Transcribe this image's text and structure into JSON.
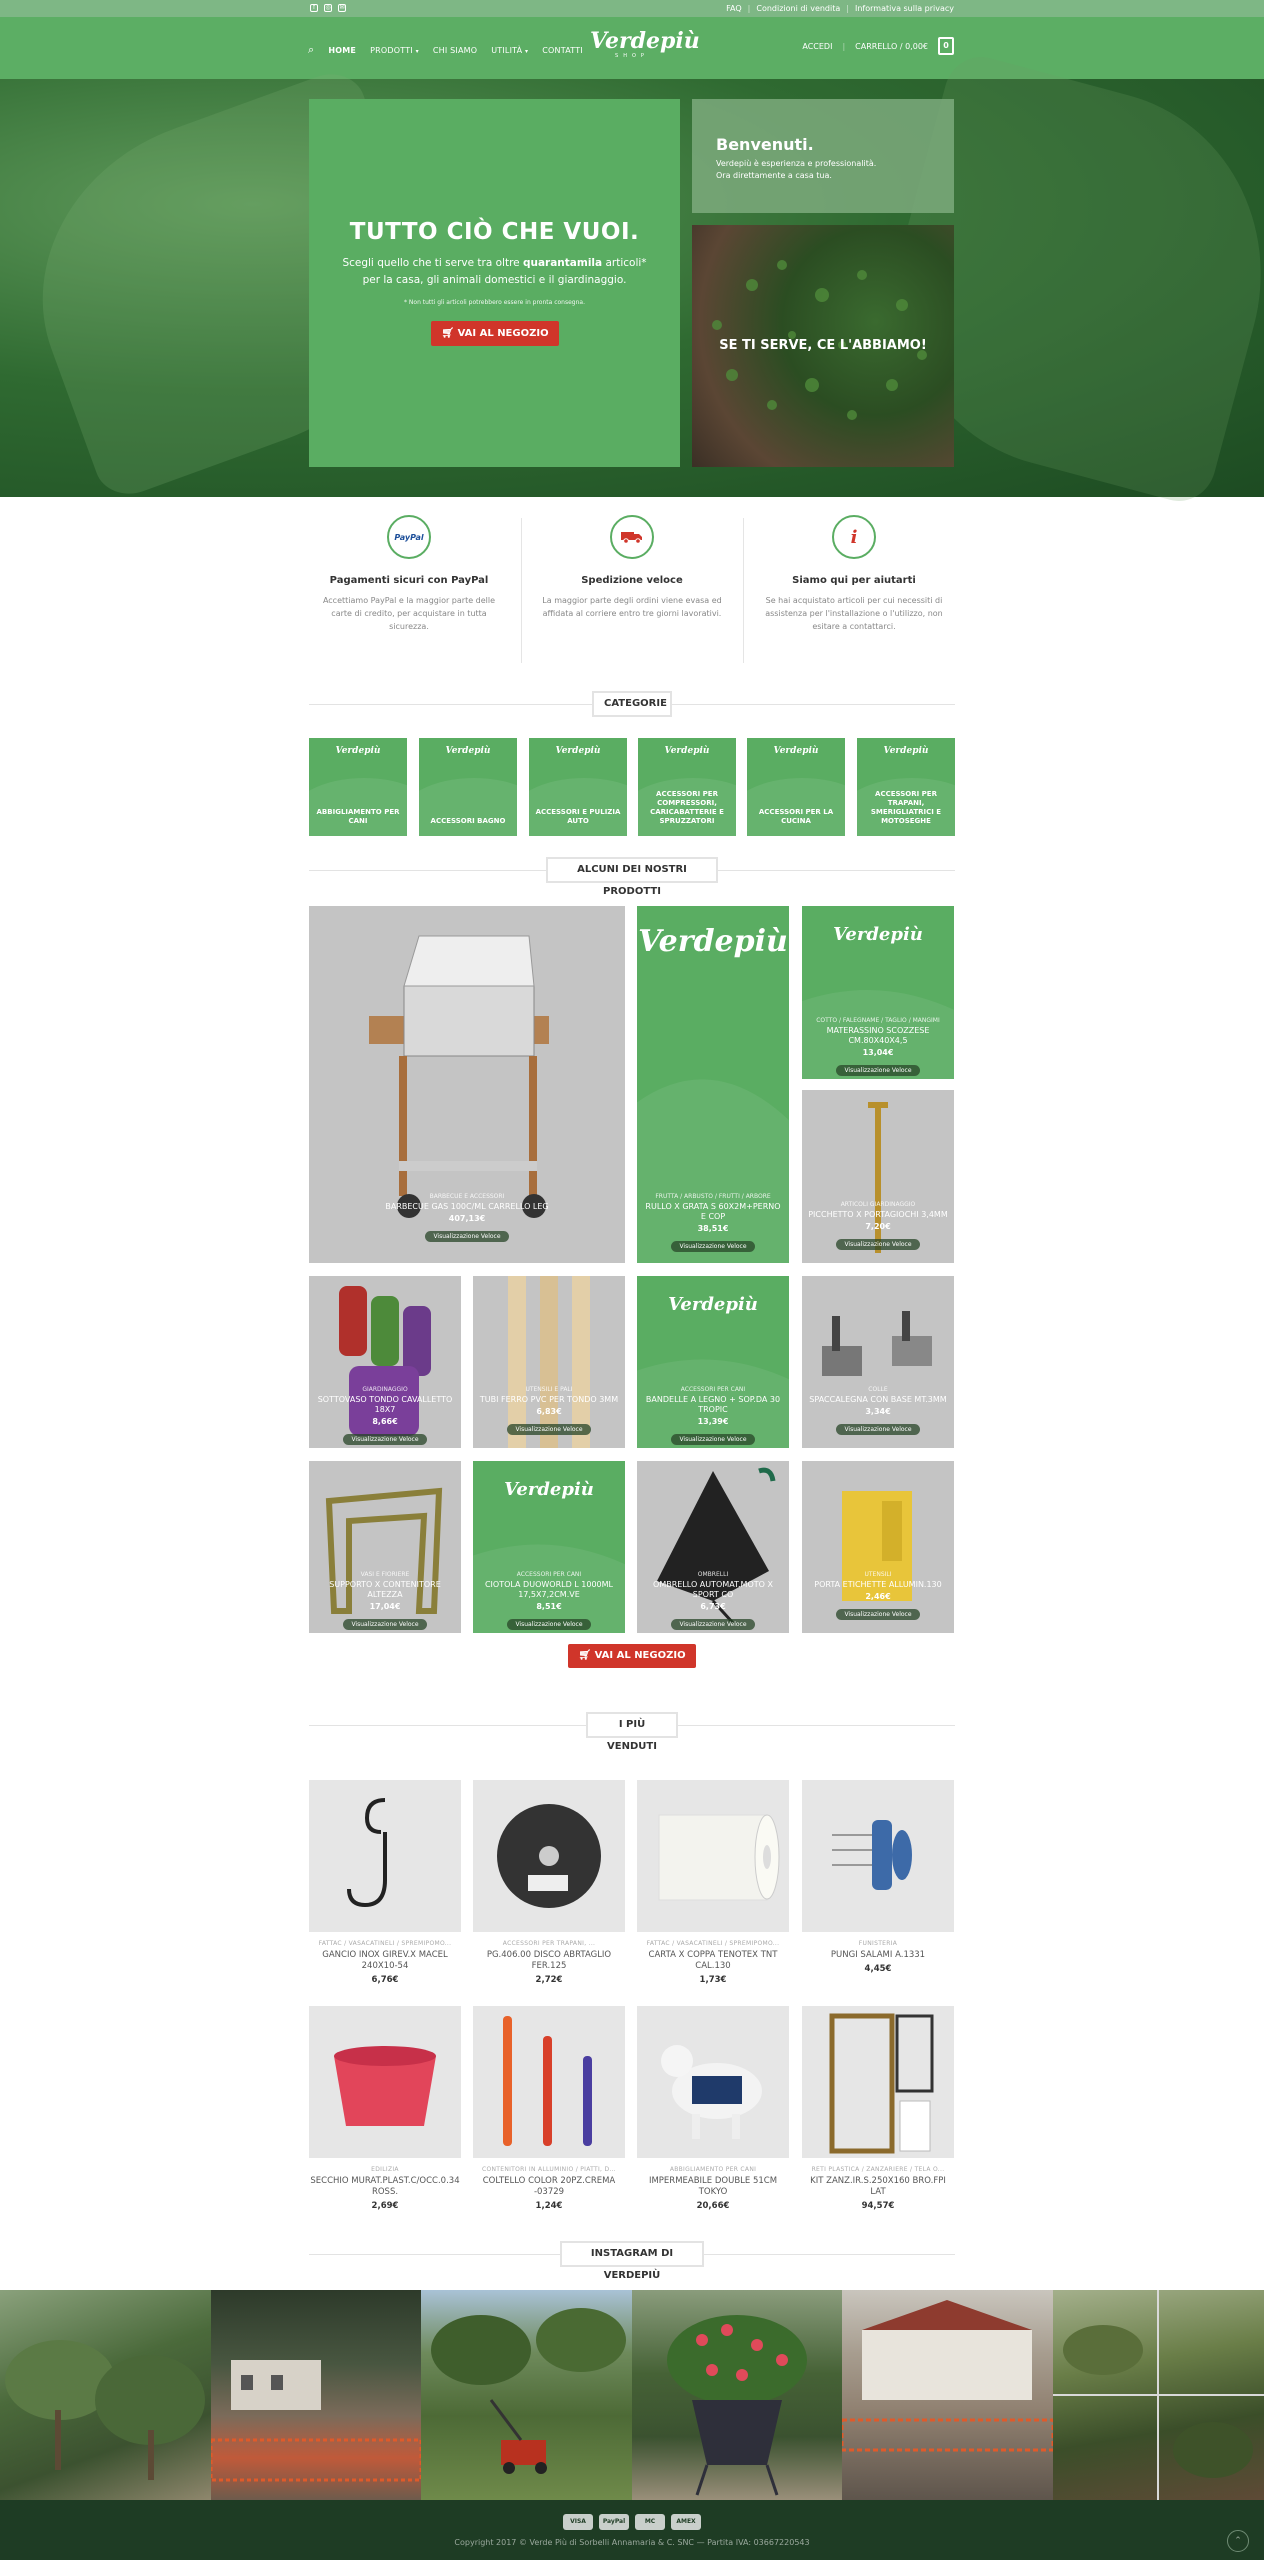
{
  "topbar": {
    "social": [
      "facebook-icon",
      "instagram-icon",
      "email-icon"
    ],
    "links": [
      "FAQ",
      "Condizioni di vendita",
      "Informativa sulla privacy"
    ]
  },
  "header": {
    "nav": [
      "HOME",
      "PRODOTTI",
      "CHI SIAMO",
      "UTILITÀ",
      "CONTATTI"
    ],
    "logo": "Verdepiù",
    "logo_sub": "SHOP",
    "login": "ACCEDI",
    "cart": "CARRELLO / 0,00€",
    "cart_count": "0"
  },
  "hero": {
    "title": "TUTTO CIÒ CHE VUOI.",
    "text_a": "Scegli quello che ti serve tra oltre ",
    "text_b": "quarantamila",
    "text_c": " articoli* per la casa, gli animali domestici e il giardinaggio.",
    "note": "* Non tutti gli articoli potrebbero essere in pronta consegna.",
    "button": "VAI AL NEGOZIO",
    "welcome_title": "Benvenuti.",
    "welcome_line1": "Verdepiù è esperienza e professionalità.",
    "welcome_line2": "Ora direttamente a casa tua.",
    "serve": "SE TI SERVE, CE L'ABBIAMO!"
  },
  "features": [
    {
      "icon": "paypal-icon",
      "icon_text": "PayPal",
      "title": "Pagamenti sicuri con PayPal",
      "text": "Accettiamo PayPal e la maggior parte delle carte di credito, per acquistare in tutta sicurezza."
    },
    {
      "icon": "truck-icon",
      "icon_text": "",
      "title": "Spedizione veloce",
      "text": "La maggior parte degli ordini viene evasa ed affidata al corriere entro tre giorni lavorativi."
    },
    {
      "icon": "info-icon",
      "icon_text": "i",
      "title": "Siamo qui per aiutarti",
      "text": "Se hai acquistato articoli per cui necessiti di assistenza per l'installazione o l'utilizzo, non esitare a contattarci."
    }
  ],
  "categories": {
    "title": "CATEGORIE",
    "items": [
      "ABBIGLIAMENTO PER CANI",
      "ACCESSORI BAGNO",
      "ACCESSORI E PULIZIA AUTO",
      "ACCESSORI PER COMPRESSORI, CARICABATTERIE E SPRUZZATORI",
      "ACCESSORI PER LA CUCINA",
      "ACCESSORI PER TRAPANI, SMERIGLIATRICI E MOTOSEGHE"
    ]
  },
  "products": {
    "title": "ALCUNI DEI NOSTRI PRODOTTI",
    "quick_view": "Visualizzazione Veloce",
    "items": [
      {
        "cat": "BARBECUE E ACCESSORI",
        "name": "BARBECUE GAS 100C/ML CARRELLO LEG",
        "price": "407,13€",
        "img": "bbq"
      },
      {
        "cat": "FRUTTA / ARBUSTO / FRUTTI / ARBORE",
        "name": "RULLO X GRATA S 60X2M+PERNO E COP",
        "price": "38,51€",
        "img": "logo"
      },
      {
        "cat": "COTTO / FALEGNAME / TAGLIO / MANGIMI",
        "name": "MATERASSINO SCOZZESE CM.80X40X4,5",
        "price": "13,04€",
        "img": "logo"
      },
      {
        "cat": "ARTICOLI GIARDINAGGIO",
        "name": "PICCHETTO X PORTAGIOCHI 3,4MM",
        "price": "7,20€",
        "img": "stake"
      },
      {
        "cat": "GIARDINAGGIO",
        "name": "SOTTOVASO TONDO CAVALLETTO 18X7",
        "price": "8,66€",
        "img": "mallets"
      },
      {
        "cat": "UTENSILI E PALI",
        "name": "TUBI FERRO PVC PER TONDO 3MM",
        "price": "6,83€",
        "img": "poles"
      },
      {
        "cat": "ACCESSORI PER CANI",
        "name": "BANDELLE A LEGNO + SOP.DA 30 TROPIC",
        "price": "13,39€",
        "img": "logo"
      },
      {
        "cat": "COLLE",
        "name": "SPACCALEGNA CON BASE MT.3MM",
        "price": "3,34€",
        "img": "tools"
      },
      {
        "cat": "VASI E FIORIERE",
        "name": "SUPPORTO X CONTENITORE ALTEZZA",
        "price": "17,04€",
        "img": "stand"
      },
      {
        "cat": "ACCESSORI PER CANI",
        "name": "CIOTOLA DUOWORLD L 1000ML 17,5X7,2CM.VE",
        "price": "8,51€",
        "img": "logo"
      },
      {
        "cat": "OMBRELLI",
        "name": "OMBRELLO AUTOMAT.MOTO X SPORT CO",
        "price": "6,73€",
        "img": "umbrella"
      },
      {
        "cat": "UTENSILI",
        "name": "PORTA ETICHETTE ALLUMIN.130",
        "price": "2,46€",
        "img": "yellow"
      }
    ],
    "button": "VAI AL NEGOZIO"
  },
  "bestsellers": {
    "title": "I PIÙ VENDUTI",
    "items": [
      {
        "cat": "FATTAC / VASACATINELI / SPREMIPOMO...",
        "name": "GANCIO INOX GIREV.X MACEL 240X10-54",
        "price": "6,76€",
        "img": "hook"
      },
      {
        "cat": "ACCESSORI PER TRAPANI, ...",
        "name": "PG.406.00 DISCO ABRTAGLIO FER.125",
        "price": "2,72€",
        "img": "disc"
      },
      {
        "cat": "FATTAC / VASACATINELI / SPREMIPOMO...",
        "name": "CARTA X COPPA TENOTEX TNT CAL.130",
        "price": "1,73€",
        "img": "roll"
      },
      {
        "cat": "FUNISTERIA",
        "name": "PUNGI SALAMI A.1331",
        "price": "4,45€",
        "img": "pricker"
      },
      {
        "cat": "EDILIZIA",
        "name": "SECCHIO MURAT.PLAST.C/OCC.0.34 ROSS.",
        "price": "2,69€",
        "img": "bucket"
      },
      {
        "cat": "CONTENITORI IN ALLUMINIO / PIATTI, D...",
        "name": "COLTELLO COLOR 20PZ.CREMA -03729",
        "price": "1,24€",
        "img": "knives"
      },
      {
        "cat": "ABBIGLIAMENTO PER CANI",
        "name": "IMPERMEABILE DOUBLE 51CM TOKYO",
        "price": "20,66€",
        "img": "dog"
      },
      {
        "cat": "RETI PLASTICA / ZANZARIERE / TELA O...",
        "name": "KIT ZANZ.IR.S.250X160 BRO.FPI LAT",
        "price": "94,57€",
        "img": "door"
      }
    ]
  },
  "instagram": {
    "title": "INSTAGRAM DI VERDEPIÙ"
  },
  "footer": {
    "payments": [
      "VISA",
      "PayPal",
      "MC",
      "AMEX"
    ],
    "copyright": "Copyright 2017 © Verde Più di Sorbelli Annamaria & C. SNC — Partita IVA: 03667220543"
  },
  "colors": {
    "green": "#5aad62",
    "header_green": "#5cae64",
    "red": "#d0352a",
    "footer": "#1e3c24"
  }
}
